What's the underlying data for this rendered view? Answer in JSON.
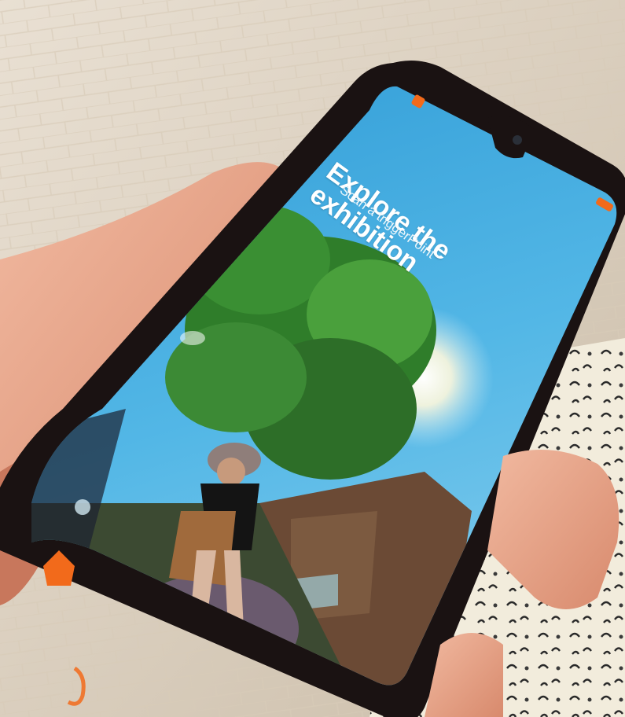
{
  "screen": {
    "title": "Explore the exhibition",
    "subtitle": "Scan a triggerPoint"
  },
  "colors": {
    "sky": "#3fa6d9",
    "accent": "#f26a1b",
    "phone_frame": "#1a1212"
  },
  "icons": [
    "close-icon",
    "menu-icon",
    "home-icon",
    "scan-icon"
  ]
}
